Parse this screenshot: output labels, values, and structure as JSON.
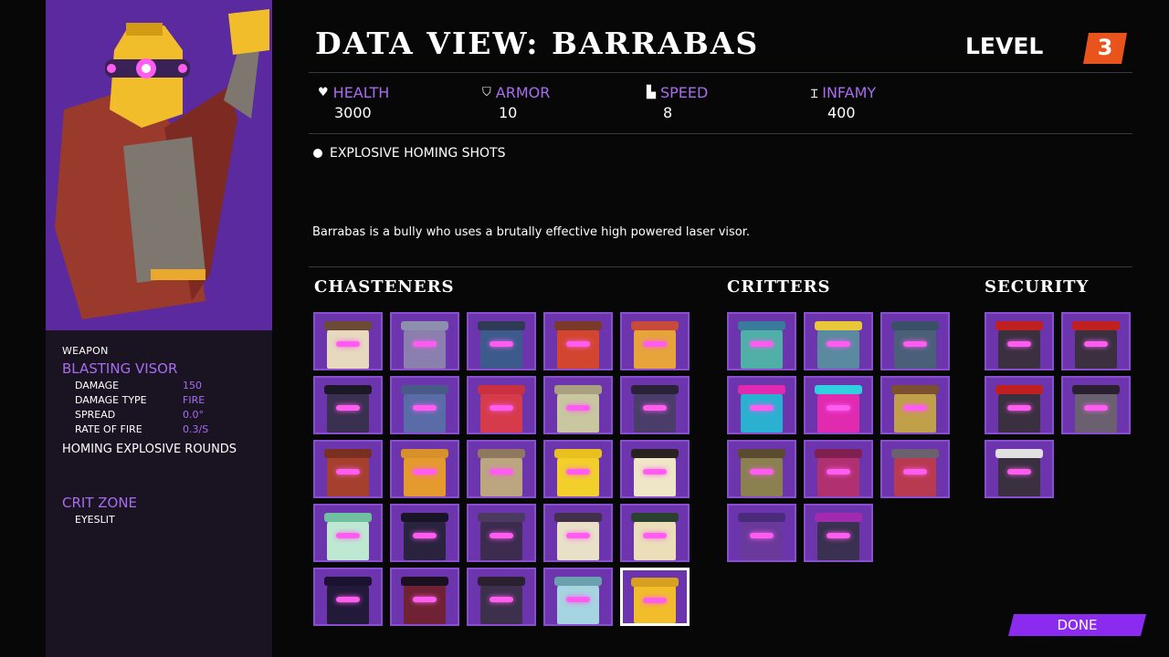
{
  "header": {
    "title": "DATA VIEW: BARRABAS",
    "level_label": "LEVEL",
    "level_value": "3"
  },
  "stats": [
    {
      "label": "HEALTH",
      "value": "3000",
      "icon": "heart-icon"
    },
    {
      "label": "ARMOR",
      "value": "10",
      "icon": "shield-icon"
    },
    {
      "label": "SPEED",
      "value": "8",
      "icon": "boot-icon"
    },
    {
      "label": "INFAMY",
      "value": "400",
      "icon": "infamy-icon"
    }
  ],
  "ability": "EXPLOSIVE HOMING SHOTS",
  "description": "Barrabas is a bully who uses a brutally effective high powered laser visor.",
  "weapon": {
    "section_label": "WEAPON",
    "name": "BLASTING VISOR",
    "rows": [
      {
        "key": "DAMAGE",
        "value": "150"
      },
      {
        "key": "DAMAGE TYPE",
        "value": "FIRE"
      },
      {
        "key": "SPREAD",
        "value": "0.0°"
      },
      {
        "key": "RATE OF FIRE",
        "value": "0.3/S"
      }
    ],
    "extra": "HOMING EXPLOSIVE ROUNDS",
    "crit_title": "CRIT ZONE",
    "crit_value": "EYESLIT"
  },
  "categories": {
    "chasteners": "CHASTENERS",
    "critters": "CRITTERS",
    "security": "SECURITY"
  },
  "done_label": "DONE",
  "colors": {
    "accent": "#a96cf0",
    "tile": "#6c34ad",
    "level_badge": "#e8541c",
    "done_button": "#8b2bf0"
  }
}
